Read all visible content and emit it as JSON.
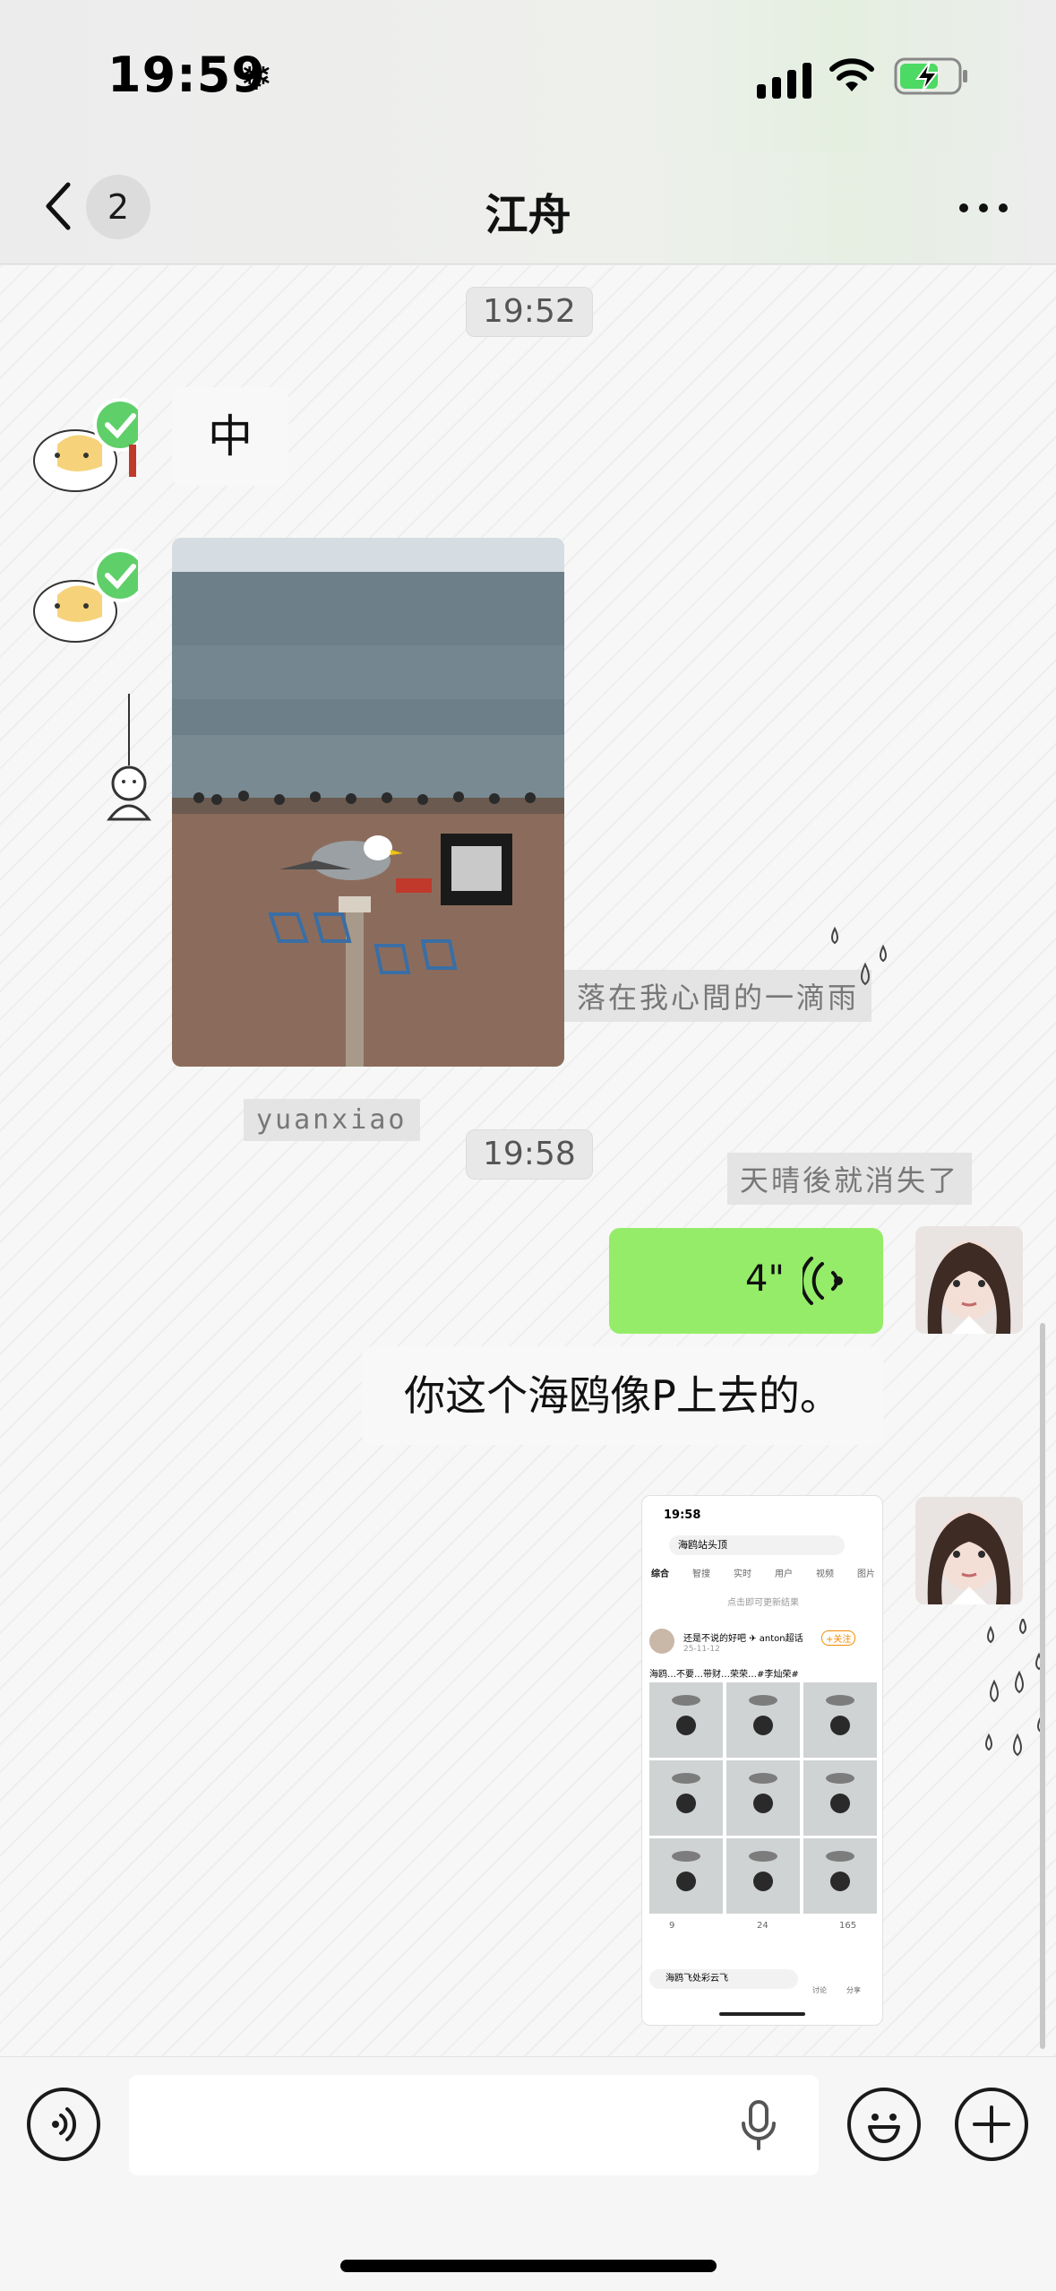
{
  "status_bar": {
    "time": "19:59",
    "weather_icon": "snowflake-icon",
    "icons": [
      "signal-icon",
      "wifi-icon",
      "battery-charging-icon"
    ]
  },
  "nav": {
    "back_icon": "chevron-left-icon",
    "unread_count": "2",
    "title": "江舟",
    "more_icon": "more-dots-icon"
  },
  "chat": {
    "timestamps": [
      "19:52",
      "19:58"
    ],
    "decor_tags": [
      "yuanxiao",
      "落在我心間的一滴雨",
      "天晴後就消失了"
    ],
    "messages": [
      {
        "side": "left",
        "type": "text",
        "text": "中"
      },
      {
        "side": "left",
        "type": "image",
        "description": "seagull-on-post-beach-photo"
      },
      {
        "side": "right",
        "type": "voice",
        "duration": "4\"",
        "icon": "voice-wave-icon"
      },
      {
        "side": "right",
        "type": "text",
        "text": "你这个海鸥像P上去的。"
      },
      {
        "side": "right",
        "type": "screenshot"
      }
    ],
    "shared_screenshot": {
      "time": "19:58",
      "search_text": "海鸥站头顶",
      "tabs": [
        "综合",
        "智搜",
        "实时",
        "用户",
        "视频",
        "图片"
      ],
      "refresh_hint": "点击即可更新结果",
      "post_user": "还是不说的好吧 ✈ anton超话",
      "post_date": "25-11-12",
      "post_text": "海鸥…不要…带财…荣荣…#李灿荣#",
      "follow_label": "+关注",
      "stats": [
        "9",
        "24",
        "165"
      ],
      "bottom_search": "海鸥飞处彩云飞",
      "bottom_actions": [
        "讨论",
        "分享"
      ]
    }
  },
  "input_bar": {
    "voice_icon": "voice-mode-icon",
    "mic_icon": "microphone-icon",
    "emoji_icon": "emoji-icon",
    "plus_icon": "plus-icon",
    "input_value": ""
  },
  "colors": {
    "green_bubble": "#95ec69",
    "white_bubble": "#f8f8f8",
    "background": "#f7f7f7"
  }
}
